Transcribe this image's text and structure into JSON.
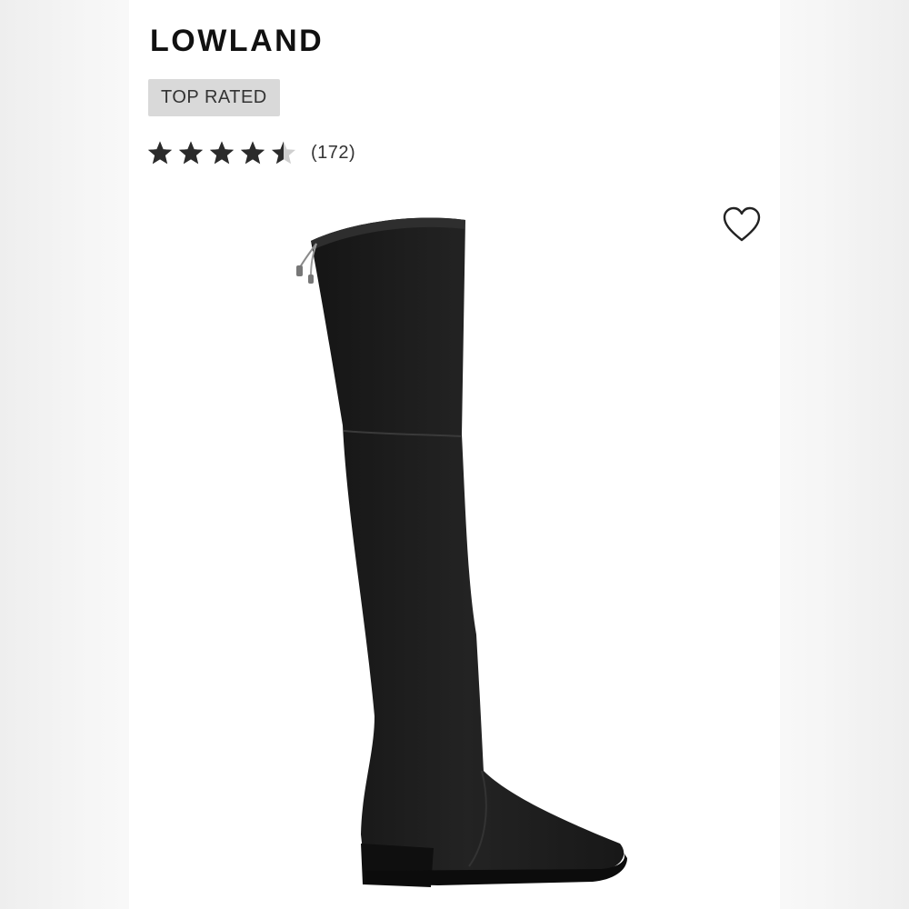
{
  "product": {
    "name": "LOWLAND",
    "badge": "TOP RATED",
    "rating": {
      "value": 4.5,
      "max": 5,
      "count_label": "(172)"
    },
    "image": {
      "subject": "black over-the-knee flat boot"
    }
  },
  "icons": {
    "favorite": "heart-outline-icon",
    "star": "star-icon"
  },
  "colors": {
    "star": "#2b2b2b",
    "badge_bg": "#d9d9d9",
    "boot": "#1c1c1c"
  }
}
